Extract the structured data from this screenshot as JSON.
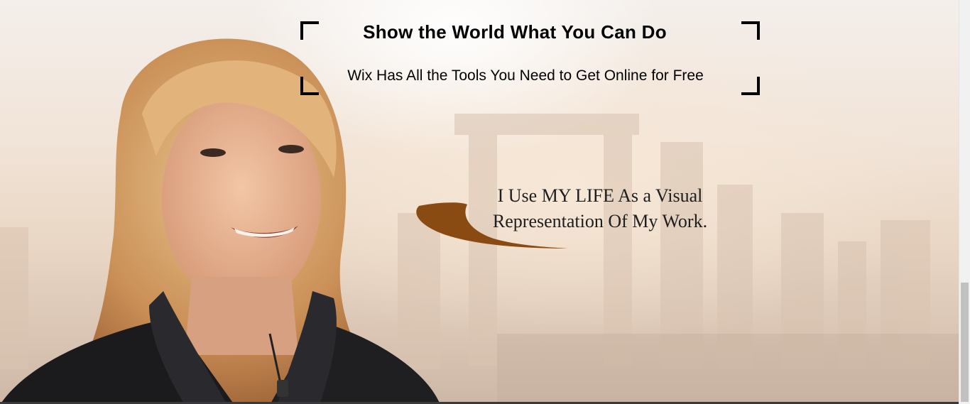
{
  "hero": {
    "headline": "Show the World What You Can Do",
    "subheadline": "Wix Has All the Tools You Need to Get Online for Free",
    "quote_line1": "I Use MY LIFE As a Visual",
    "quote_line2": "Representation Of My Work."
  },
  "colors": {
    "swoosh": "#8a4b12",
    "frame": "#000000",
    "scrollbar_thumb": "#c1c1c1"
  }
}
